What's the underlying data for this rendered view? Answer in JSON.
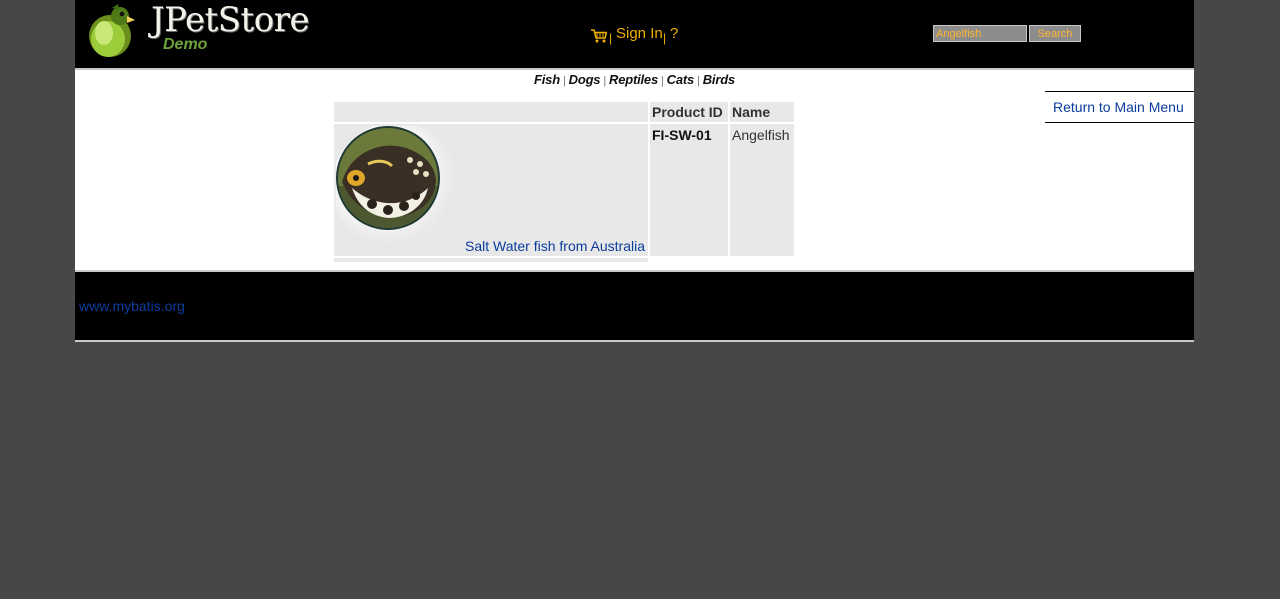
{
  "header": {
    "brand": "JPetStore",
    "brand_sub": "Demo",
    "sign_in": "Sign In",
    "help": "?",
    "menu_separator": "|",
    "search_value": "Angelfish",
    "search_button": "Search"
  },
  "quicklinks": {
    "items": [
      "Fish",
      "Dogs",
      "Reptiles",
      "Cats",
      "Birds"
    ],
    "separator": "|"
  },
  "back_link": "Return to Main Menu",
  "table": {
    "headers": [
      "Product ID",
      "Name"
    ],
    "rows": [
      {
        "description": "Salt Water fish from Australia",
        "product_id": "FI-SW-01",
        "name": "Angelfish"
      }
    ]
  },
  "footer": {
    "link": "www.mybatis.org"
  },
  "colors": {
    "page_bg": "#474747",
    "header_bg": "#000000",
    "menu_accent": "#f0b000",
    "link_blue": "#0b3c9e",
    "table_cell": "#e8e8e8"
  },
  "icons": [
    "parrot-logo",
    "cart-icon",
    "fish-image"
  ]
}
